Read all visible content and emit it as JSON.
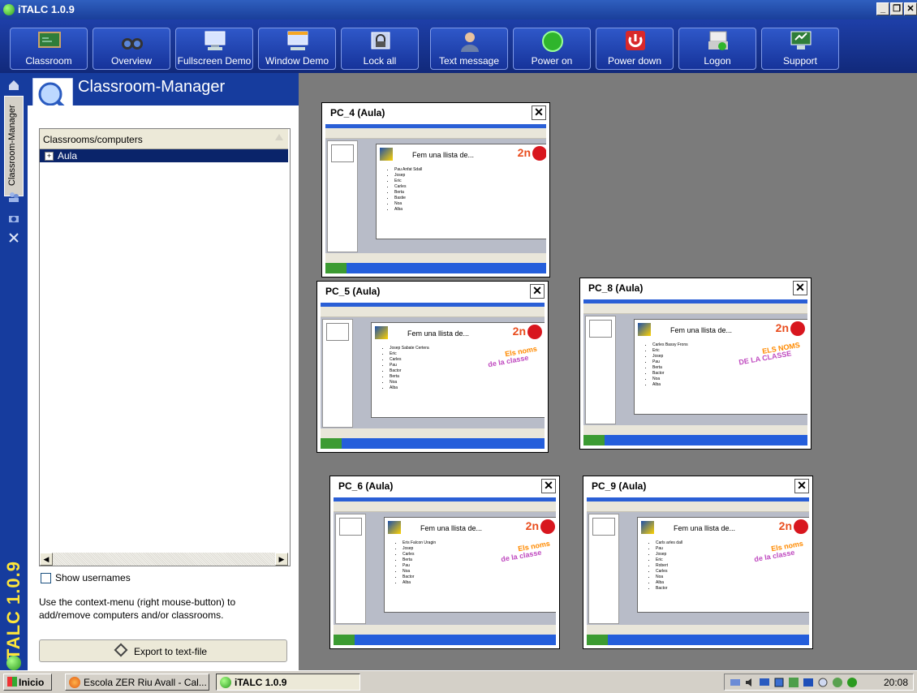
{
  "window": {
    "title": "iTALC 1.0.9"
  },
  "toolbar": {
    "buttons": [
      {
        "label": "Classroom",
        "icon": "classroom-icon"
      },
      {
        "label": "Overview",
        "icon": "binoculars-icon"
      },
      {
        "label": "Fullscreen Demo",
        "icon": "fullscreen-demo-icon"
      },
      {
        "label": "Window Demo",
        "icon": "window-demo-icon"
      },
      {
        "label": "Lock all",
        "icon": "lock-icon"
      },
      {
        "label": "Text message",
        "icon": "person-message-icon"
      },
      {
        "label": "Power on",
        "icon": "power-on-icon"
      },
      {
        "label": "Power down",
        "icon": "power-down-icon"
      },
      {
        "label": "Logon",
        "icon": "logon-icon"
      },
      {
        "label": "Support",
        "icon": "support-icon"
      }
    ]
  },
  "sidebar": {
    "vertical_tab": "Classroom-Manager",
    "brand": "iTALC 1.0.9"
  },
  "classroom_manager": {
    "title": "Classroom-Manager",
    "tree_header": "Classrooms/computers",
    "tree_items": [
      {
        "label": "Aula",
        "expand": "+"
      }
    ],
    "show_usernames_label": "Show usernames",
    "help_text": "Use the context-menu (right mouse-button) to add/remove computers and/or classrooms.",
    "export_button": "Export to text-file"
  },
  "computers": [
    {
      "name": "PC_4 (Aula)",
      "slide_title": "Fem una llista de...",
      "badge": "2n",
      "items": [
        "Pau Anfat Sdall",
        "Josep",
        "Eric",
        "Carles",
        "Berta",
        "Bastie",
        "Noa",
        "Alba"
      ],
      "deco": "",
      "deco2": ""
    },
    {
      "name": "PC_5 (Aula)",
      "slide_title": "Fem una llista de...",
      "badge": "2n",
      "items": [
        "Josep Sabate Certera",
        "Eric",
        "Carles",
        "Pau",
        "Bactor",
        "Berta",
        "Noa",
        "Alba"
      ],
      "deco": "Els noms",
      "deco2": "de la classe"
    },
    {
      "name": "PC_8 (Aula)",
      "slide_title": "Fem una llista de...",
      "badge": "2n",
      "items": [
        "Carles Bassy Frons",
        "Eric",
        "Josep",
        "Pau",
        "Berta",
        "Bactor",
        "Noa",
        "Alba"
      ],
      "deco": "ELS NOMS",
      "deco2": "DE LA CLASSE"
    },
    {
      "name": "PC_6 (Aula)",
      "slide_title": "Fem una llista de...",
      "badge": "2n",
      "items": [
        "Eris Falcon Uragin",
        "Josep",
        "Carles",
        "Berta",
        "Pau",
        "Noa",
        "Bactor",
        "Alba"
      ],
      "deco": "Els noms",
      "deco2": "de la classe"
    },
    {
      "name": "PC_9 (Aula)",
      "slide_title": "Fem una llista de...",
      "badge": "2n",
      "items": [
        "Carls arles dall",
        "Pau",
        "Josep",
        "Eric",
        "Robert",
        "Carles",
        "Noa",
        "Alba",
        "Bactor"
      ],
      "deco": "Els noms",
      "deco2": "de la classe"
    }
  ],
  "taskbar": {
    "start": "Inicio",
    "tasks": [
      {
        "label": "Escola ZER Riu Avall - Cal..."
      },
      {
        "label": "iTALC 1.0.9"
      }
    ],
    "clock": "20:08"
  }
}
